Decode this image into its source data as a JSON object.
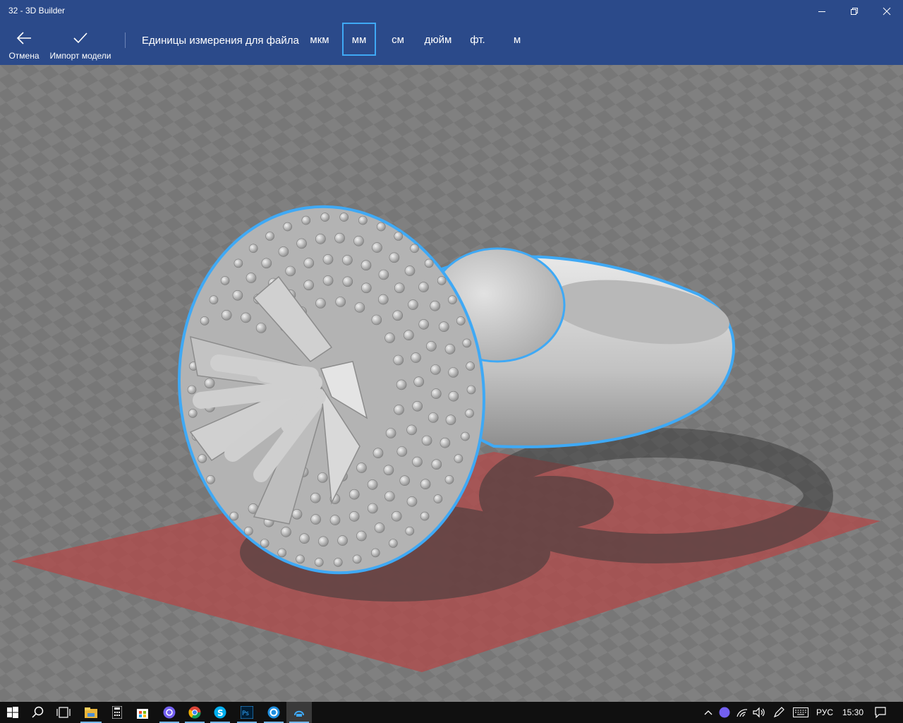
{
  "window": {
    "title": "32 - 3D Builder"
  },
  "toolbar": {
    "cancel_label": "Отмена",
    "import_label": "Импорт модели",
    "units_label": "Единицы измерения для файла",
    "units": [
      "мкм",
      "мм",
      "см",
      "дюйм",
      "фт.",
      "м"
    ],
    "selected_unit": "мм"
  },
  "colors": {
    "titlebar": "#2b4a8a",
    "accent": "#3fa9f5",
    "build_plate": "#b04a4a",
    "model": "#c9c9c9",
    "taskbar": "#101010"
  },
  "taskbar": {
    "apps": [
      "start-icon",
      "search-icon",
      "task-view-icon",
      "file-explorer-icon",
      "calculator-icon",
      "store-icon",
      "viber-icon",
      "chrome-icon",
      "skype-icon",
      "photoshop-icon",
      "browser-icon",
      "3d-builder-icon"
    ],
    "language": "РУС",
    "time": "15:30"
  }
}
